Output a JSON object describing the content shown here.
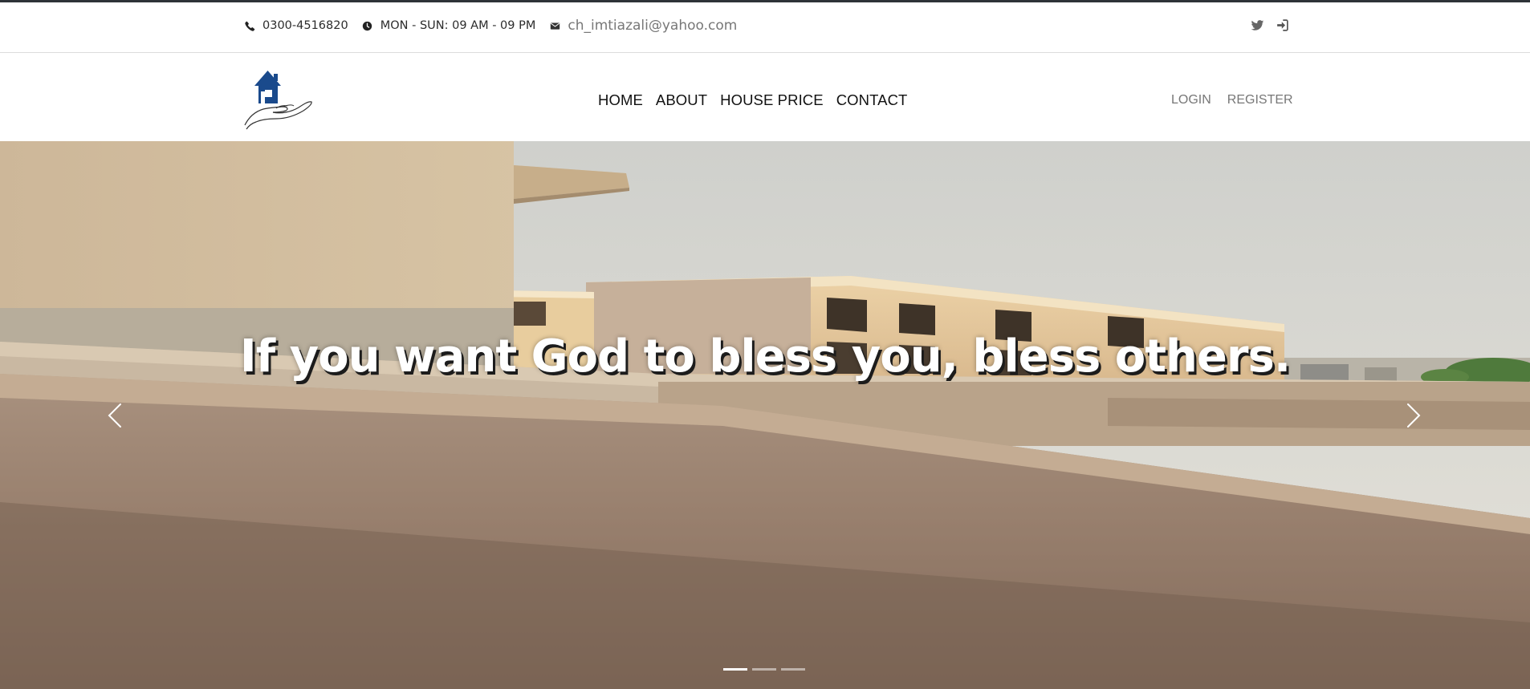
{
  "topbar": {
    "phone": "0300-4516820",
    "hours": "MON - SUN: 09 AM - 09 PM",
    "email": "ch_imtiazali@yahoo.com",
    "icons": [
      "phone-icon",
      "clock-icon",
      "envelope-icon",
      "twitter-icon",
      "sign-in-icon"
    ]
  },
  "nav": {
    "items": [
      {
        "label": "HOME"
      },
      {
        "label": "ABOUT"
      },
      {
        "label": "HOUSE PRICE"
      },
      {
        "label": "CONTACT"
      }
    ],
    "login": "LOGIN",
    "register": "REGISTER"
  },
  "hero": {
    "caption": "If you want God to bless you, bless others.",
    "slides_count": 3,
    "active_slide": 1
  },
  "colors": {
    "logo_blue": "#1a4a8c",
    "topbar_border": "#2e3338",
    "muted_text": "#777777"
  }
}
